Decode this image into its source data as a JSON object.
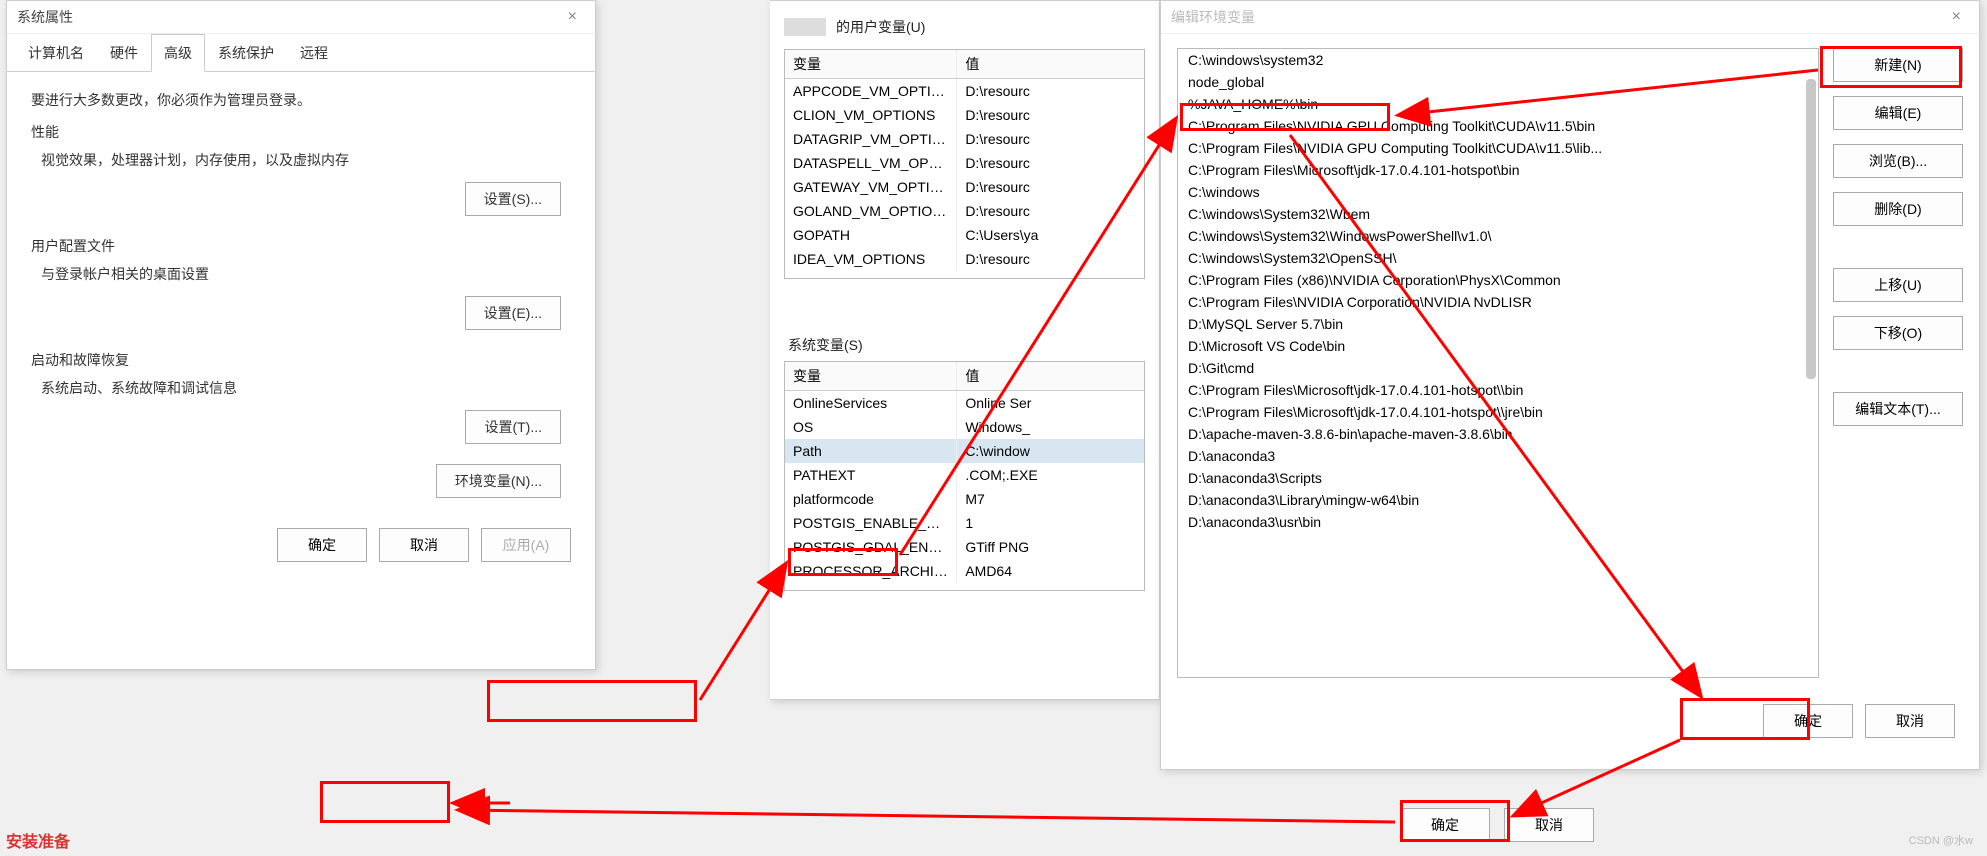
{
  "sysProps": {
    "title": "系统属性",
    "tabs": [
      "计算机名",
      "硬件",
      "高级",
      "系统保护",
      "远程"
    ],
    "activeTab": 2,
    "notice": "要进行大多数更改，你必须作为管理员登录。",
    "perf": {
      "title": "性能",
      "desc": "视觉效果，处理器计划，内存使用，以及虚拟内存",
      "btn": "设置(S)..."
    },
    "profile": {
      "title": "用户配置文件",
      "desc": "与登录帐户相关的桌面设置",
      "btn": "设置(E)..."
    },
    "startup": {
      "title": "启动和故障恢复",
      "desc": "系统启动、系统故障和调试信息",
      "btn": "设置(T)..."
    },
    "envBtn": "环境变量(N)...",
    "ok": "确定",
    "cancel": "取消",
    "apply": "应用(A)"
  },
  "envDlg": {
    "userLabel": "的用户变量(U)",
    "sysLabel": "系统变量(S)",
    "headerVar": "变量",
    "headerVal": "值",
    "userVars": [
      {
        "var": "APPCODE_VM_OPTIONS",
        "val": "D:\\resourc"
      },
      {
        "var": "CLION_VM_OPTIONS",
        "val": "D:\\resourc"
      },
      {
        "var": "DATAGRIP_VM_OPTIONS",
        "val": "D:\\resourc"
      },
      {
        "var": "DATASPELL_VM_OPTIONS",
        "val": "D:\\resourc"
      },
      {
        "var": "GATEWAY_VM_OPTIONS",
        "val": "D:\\resourc"
      },
      {
        "var": "GOLAND_VM_OPTIONS",
        "val": "D:\\resourc"
      },
      {
        "var": "GOPATH",
        "val": "C:\\Users\\ya"
      },
      {
        "var": "IDEA_VM_OPTIONS",
        "val": "D:\\resourc"
      }
    ],
    "sysVars": [
      {
        "var": "OnlineServices",
        "val": "Online Ser"
      },
      {
        "var": "OS",
        "val": "Windows_"
      },
      {
        "var": "Path",
        "val": "C:\\window"
      },
      {
        "var": "PATHEXT",
        "val": ".COM;.EXE"
      },
      {
        "var": "platformcode",
        "val": "M7"
      },
      {
        "var": "POSTGIS_ENABLE_OUTDB_R...",
        "val": "1"
      },
      {
        "var": "POSTGIS_GDAL_ENABLED_D...",
        "val": "GTiff PNG"
      },
      {
        "var": "PROCESSOR_ARCHITECTURE",
        "val": "AMD64"
      }
    ],
    "selectedSys": 2,
    "ok": "确定",
    "cancel": "取消"
  },
  "pathDlg": {
    "title": "编辑环境变量",
    "items": [
      "C:\\windows\\system32",
      "node_global",
      "%JAVA_HOME%\\bin",
      "C:\\Program Files\\NVIDIA GPU Computing Toolkit\\CUDA\\v11.5\\bin",
      "C:\\Program Files\\NVIDIA GPU Computing Toolkit\\CUDA\\v11.5\\lib...",
      "C:\\Program Files\\Microsoft\\jdk-17.0.4.101-hotspot\\bin",
      "C:\\windows",
      "C:\\windows\\System32\\Wbem",
      "C:\\windows\\System32\\WindowsPowerShell\\v1.0\\",
      "C:\\windows\\System32\\OpenSSH\\",
      "C:\\Program Files (x86)\\NVIDIA Corporation\\PhysX\\Common",
      "C:\\Program Files\\NVIDIA Corporation\\NVIDIA NvDLISR",
      "D:\\MySQL Server 5.7\\bin",
      "D:\\Microsoft VS Code\\bin",
      "D:\\Git\\cmd",
      "C:\\Program Files\\Microsoft\\jdk-17.0.4.101-hotspot\\\\bin",
      "C:\\Program Files\\Microsoft\\jdk-17.0.4.101-hotspot\\\\jre\\bin",
      "D:\\apache-maven-3.8.6-bin\\apache-maven-3.8.6\\bin",
      "D:\\anaconda3",
      "D:\\anaconda3\\Scripts",
      "D:\\anaconda3\\Library\\mingw-w64\\bin",
      "D:\\anaconda3\\usr\\bin"
    ],
    "btns": {
      "new": "新建(N)",
      "edit": "编辑(E)",
      "browse": "浏览(B)...",
      "delete": "删除(D)",
      "up": "上移(U)",
      "down": "下移(O)",
      "editText": "编辑文本(T)..."
    },
    "ok": "确定",
    "cancel": "取消"
  },
  "bottomText": "安装准备",
  "watermark": "CSDN @水w"
}
